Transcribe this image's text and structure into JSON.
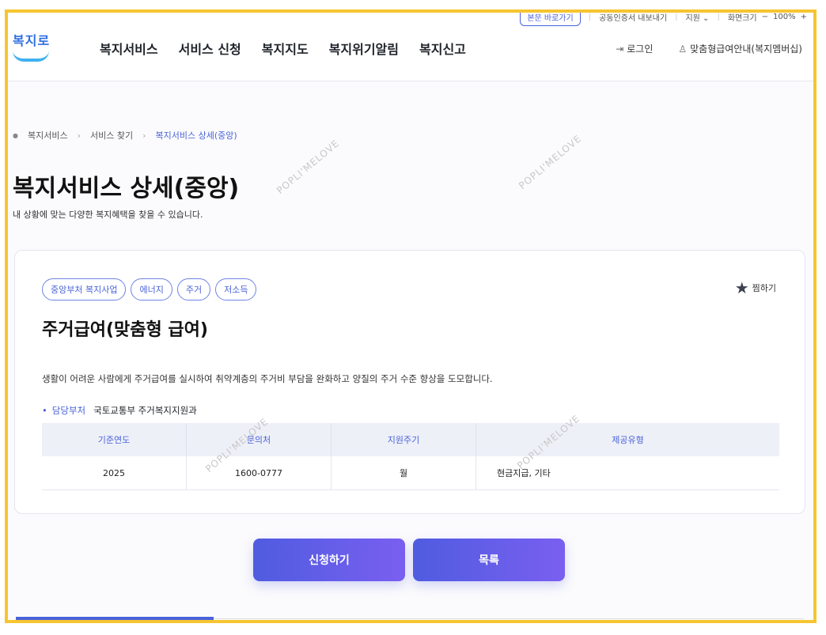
{
  "util_bar": {
    "skip_link": "본문 바로가기",
    "cert_export": "공동인증서 내보내기",
    "region": "지원",
    "zoom_label": "화면크기",
    "zoom_minus": "−",
    "zoom_value": "100%",
    "zoom_plus": "+"
  },
  "header": {
    "logo_text": "복지로",
    "nav": [
      "복지서비스",
      "서비스 신청",
      "복지지도",
      "복지위기알림",
      "복지신고"
    ],
    "login": "로그인",
    "membership": "맞춤형급여안내(복지멤버십)"
  },
  "breadcrumb": [
    "복지서비스",
    "서비스 찾기",
    "복지서비스 상세(중앙)"
  ],
  "page": {
    "title": "복지서비스 상세(중앙)",
    "subtitle": "내 상황에 맞는 다양한 복지혜택을 찾을 수 있습니다."
  },
  "service": {
    "tags": [
      "중앙부처 복지사업",
      "에너지",
      "주거",
      "저소득"
    ],
    "favorite": "찜하기",
    "title": "주거급여(맞춤형 급여)",
    "description": "생활이 어려운 사람에게 주거급여를 실시하여 취약계층의 주거비 부담을 완화하고 양질의 주거 수준 향상을 도모합니다.",
    "dept_label": "담당부처",
    "dept_value": "국토교통부 주거복지지원과",
    "table_headers": [
      "기준연도",
      "문의처",
      "지원주기",
      "제공유형"
    ],
    "table_row": [
      "2025",
      "1600-0777",
      "월",
      "현금지급, 기타"
    ]
  },
  "buttons": {
    "apply": "신청하기",
    "list": "목록"
  },
  "watermark": "POPLI'MELOVE"
}
